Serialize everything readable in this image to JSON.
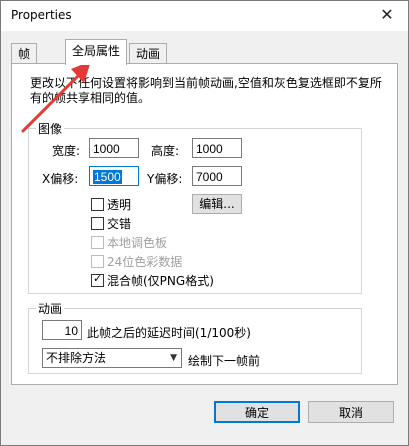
{
  "window": {
    "title": "Properties",
    "close_glyph": "✕"
  },
  "tabs": [
    {
      "label": "帧"
    },
    {
      "label": "全局属性"
    },
    {
      "label": "动画"
    }
  ],
  "description": "更改以下任何设置将影响到当前帧动画,空值和灰色复选框即不复所有的帧共享相同的值。",
  "image_group": {
    "label": "图像",
    "width_label": "宽度:",
    "width_value": "1000",
    "height_label": "高度:",
    "height_value": "1000",
    "xoffset_label": "X偏移:",
    "xoffset_value": "1500",
    "yoffset_label": "Y偏移:",
    "yoffset_value": "7000",
    "edit_button": "编辑...",
    "options": [
      {
        "label": "透明",
        "checked": false,
        "disabled": false
      },
      {
        "label": "交错",
        "checked": false,
        "disabled": false
      },
      {
        "label": "本地调色板",
        "checked": false,
        "disabled": true
      },
      {
        "label": "24位色彩数据",
        "checked": false,
        "disabled": true
      },
      {
        "label": "混合帧(仅PNG格式)",
        "checked": true,
        "disabled": false
      }
    ]
  },
  "animation_group": {
    "label": "动画",
    "delay_value": "10",
    "delay_label": "此帧之后的延迟时间(1/100秒)",
    "dispose_value": "不排除方法",
    "dispose_label": "绘制下一帧前"
  },
  "buttons": {
    "ok": "确定",
    "cancel": "取消"
  },
  "accent_color": "#0078d7",
  "arrow_color": "#e53935"
}
